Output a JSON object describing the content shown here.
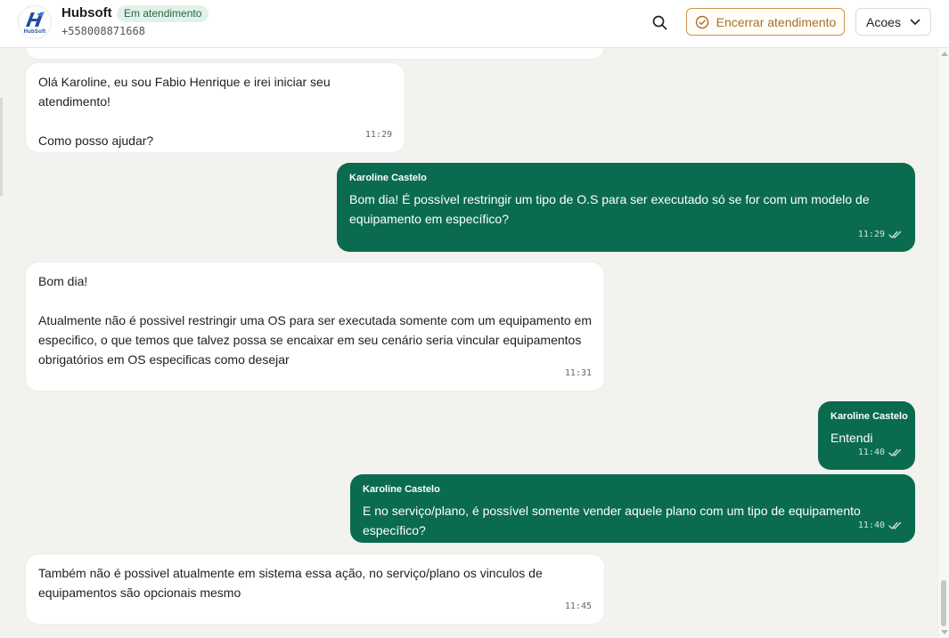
{
  "header": {
    "contact_name": "Hubsoft",
    "status_badge": "Em atendimento",
    "phone": "+558008871668",
    "avatar_logo_text": "HubSoft",
    "end_button_label": "Encerrar atendimento",
    "actions_button_label": "Acoes",
    "icons": {
      "search": "search-icon",
      "end": "check-circle-icon",
      "actions": "chevron-down-icon"
    }
  },
  "messages": [
    {
      "direction": "in",
      "text": "Olá Karoline, eu sou  Fabio Henrique e irei iniciar seu atendimento!\n\nComo posso ajudar?",
      "time": "11:29"
    },
    {
      "direction": "out",
      "sender": "Karoline Castelo",
      "text": "Bom dia! É possível restringir um tipo de O.S para ser executado só se for com um modelo de equipamento em específico?",
      "time": "11:29"
    },
    {
      "direction": "in",
      "text": "Bom dia!\n\nAtualmente não é possivel restringir uma OS para ser executada somente com um equipamento em especifico, o que temos que talvez possa se encaixar em seu cenário seria vincular equipamentos obrigatórios em OS especificas como desejar",
      "time": "11:31"
    },
    {
      "direction": "out",
      "sender": "Karoline Castelo",
      "text": "Entendi",
      "time": "11:40"
    },
    {
      "direction": "out",
      "sender": "Karoline Castelo",
      "text": "E no serviço/plano, é possível somente vender aquele plano com um tipo de equipamento específico?",
      "time": "11:40"
    },
    {
      "direction": "in",
      "text": "Também não é possivel atualmente em sistema essa ação, no serviço/plano os vinculos de equipamentos são opcionais mesmo",
      "time": "11:45"
    }
  ],
  "colors": {
    "outgoing_bubble": "#0a6b4f",
    "incoming_bubble": "#ffffff",
    "end_button_accent": "#c99549",
    "status_badge_bg": "#e3f1e8",
    "chat_background": "#f2f2ef"
  }
}
